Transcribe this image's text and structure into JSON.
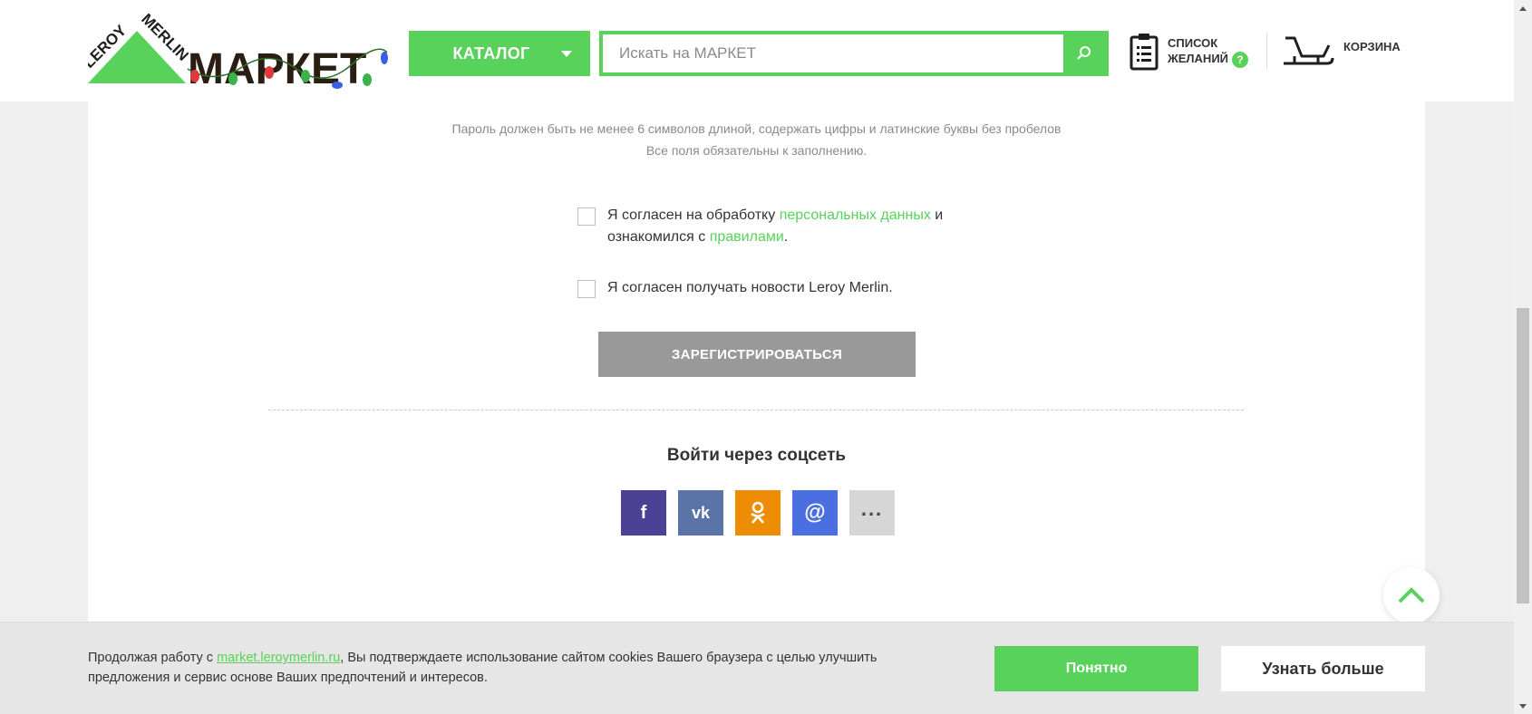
{
  "header": {
    "logo_alt": "LEROY MERLIN МАРКЕТ",
    "logo_brand_top": "LEROY",
    "logo_brand_bottom": "MERLIN",
    "logo_market": "МАРКЕТ",
    "catalog_label": "КАТАЛОГ",
    "search_placeholder": "Искать на МАРКЕТ",
    "wishlist_line1": "СПИСОК",
    "wishlist_line2": "ЖЕЛАНИЙ",
    "wishlist_help": "?",
    "cart_label": "КОРЗИНА"
  },
  "form": {
    "password_hint": "Пароль должен быть не менее 6 символов длиной, содержать цифры и латинские буквы без пробелов",
    "required_hint": "Все поля обязательны к заполнению.",
    "consent_part1": "Я согласен на обработку ",
    "consent_link1": "персональных данных",
    "consent_part2": " и",
    "consent_part3": "ознакомился с ",
    "consent_link2": "правилами",
    "consent_part4": ".",
    "news_consent": "Я согласен получать новости Leroy Merlin.",
    "register_label": "ЗАРЕГИСТРИРОВАТЬСЯ"
  },
  "social": {
    "title": "Войти через соцсеть",
    "items": [
      {
        "name": "facebook",
        "glyph": "f",
        "color": "#4b4295"
      },
      {
        "name": "vkontakte",
        "glyph": "vk",
        "color": "#5a74a8"
      },
      {
        "name": "odnoklassniki",
        "glyph": "ok",
        "color": "#ee8d03"
      },
      {
        "name": "mailru",
        "glyph": "@",
        "color": "#4b6fe0"
      },
      {
        "name": "more",
        "glyph": "...",
        "color": "#d6d6d6"
      }
    ]
  },
  "cookie": {
    "text_before": "Продолжая работу с ",
    "link": "market.leroymerlin.ru",
    "text_after": ", Вы подтверждаете использование сайтом cookies Вашего браузера с целью улучшить предложения и сервис  основе Ваших предпочтений и интересов.",
    "ok_label": "Понятно",
    "more_label": "Узнать больше"
  },
  "colors": {
    "accent": "#58d25a",
    "button_disabled": "#999999"
  }
}
